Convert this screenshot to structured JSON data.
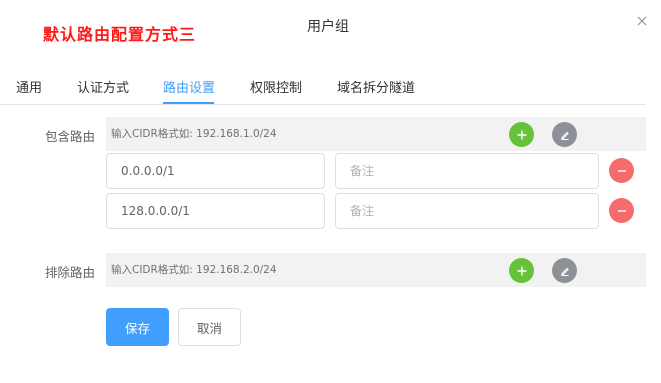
{
  "annotation": "默认路由配置方式三",
  "dialog": {
    "title": "用户组"
  },
  "tabs": [
    {
      "label": "通用"
    },
    {
      "label": "认证方式"
    },
    {
      "label": "路由设置",
      "active": true
    },
    {
      "label": "权限控制"
    },
    {
      "label": "域名拆分隧道"
    }
  ],
  "include": {
    "label": "包含路由",
    "cidr_placeholder": "输入CIDR格式如: 192.168.1.0/24",
    "routes": [
      {
        "value": "0.0.0.0/1",
        "note_placeholder": "备注"
      },
      {
        "value": "128.0.0.0/1",
        "note_placeholder": "备注"
      }
    ]
  },
  "exclude": {
    "label": "排除路由",
    "cidr_placeholder": "输入CIDR格式如: 192.168.2.0/24"
  },
  "buttons": {
    "save": "保存",
    "cancel": "取消"
  },
  "icons": {
    "add": "plus-icon",
    "edit": "pencil-icon",
    "remove": "minus-icon",
    "close": "close-icon"
  },
  "colors": {
    "accent": "#409eff",
    "add": "#67c23a",
    "edit": "#8e9097",
    "remove": "#f56c6c",
    "annotation": "#ff1a1a"
  }
}
